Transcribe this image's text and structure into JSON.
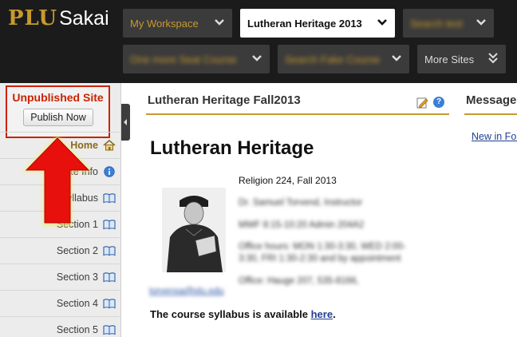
{
  "header": {
    "logo_primary": "PLU",
    "logo_secondary": "Sakai",
    "tabs": [
      {
        "label": "My Workspace"
      },
      {
        "label": "Lutheran Heritage 2013"
      },
      {
        "label": "Search test"
      },
      {
        "label": "One more Seat Course"
      },
      {
        "label": "Search Fake Course"
      },
      {
        "label": "More Sites"
      }
    ]
  },
  "status": {
    "unpublished_label": "Unpublished Site",
    "publish_button": "Publish Now"
  },
  "toolmenu": {
    "items": [
      {
        "label": "Home",
        "icon": "home-icon"
      },
      {
        "label": "Site Info",
        "icon": "info-icon"
      },
      {
        "label": "Syllabus",
        "icon": "book-icon"
      },
      {
        "label": "Section 1",
        "icon": "book-icon"
      },
      {
        "label": "Section 2",
        "icon": "book-icon"
      },
      {
        "label": "Section 3",
        "icon": "book-icon"
      },
      {
        "label": "Section 4",
        "icon": "book-icon"
      },
      {
        "label": "Section 5",
        "icon": "book-icon"
      }
    ]
  },
  "main": {
    "tool_title": "Lutheran Heritage Fall2013",
    "heading": "Lutheran Heritage",
    "course_code": "Religion 224, Fall 2013",
    "info_lines": [
      "Dr. Samuel Torvend, Instructor",
      "MWF 8:15-10:20 Admin 204A2",
      "Office hours: MON 1:30-3:30, WED 2:00-",
      "3:30, FRI 1:30-2:30 and by appointment",
      "Office: Hauge 207, 535-8166,"
    ],
    "email_link": "torvensa@plu.edu",
    "syllabus_text": "The course syllabus is available ",
    "syllabus_link": "here",
    "syllabus_end": "."
  },
  "side": {
    "title": "Messages",
    "link": "New in Forums"
  },
  "colors": {
    "accent": "#c79a2d",
    "header_bg": "#1b1b1b",
    "alert_red": "#cc2200",
    "link_blue": "#1f3f8f"
  }
}
